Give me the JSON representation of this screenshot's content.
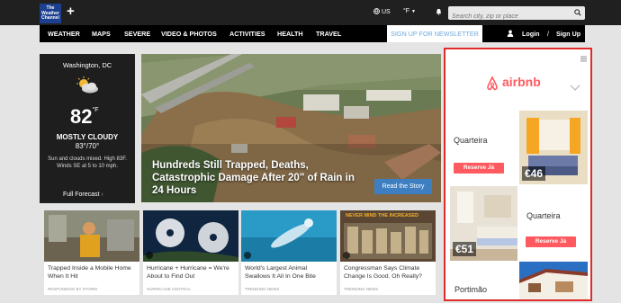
{
  "header": {
    "logo_text": "The Weather Channel",
    "location_code": "US",
    "unit": "°F",
    "search_placeholder": "Search city, zip or place"
  },
  "nav": {
    "items": [
      "WEATHER",
      "MAPS",
      "SEVERE",
      "VIDEO & PHOTOS",
      "ACTIVITIES",
      "HEALTH",
      "TRAVEL"
    ],
    "newsletter": "SIGN UP FOR NEWSLETTER",
    "login": "Login",
    "separator": "/",
    "signup": "Sign Up"
  },
  "weather": {
    "city": "Washington, DC",
    "temp": "82",
    "temp_unit": "°F",
    "condition": "MOSTLY CLOUDY",
    "hilo": "83°/70°",
    "description": "Sun and clouds mixed. High 83F. Winds SE at 5 to 10 mph.",
    "forecast_link": "Full Forecast"
  },
  "hero": {
    "title": "Hundreds Still Trapped, Deaths, Catastrophic Damage After 20\" of Rain in 24 Hours",
    "button": "Read the Story"
  },
  "cards": [
    {
      "title": "Trapped Inside a Mobile Home When It Hit",
      "source": "RESPONDING BY STORM"
    },
    {
      "title": "Hurricane + Hurricane = We're About to Find Out",
      "source": "HURRICANE CENTRAL"
    },
    {
      "title": "World's Largest Animal Swallows It All In One Bite",
      "source": "TRENDING NEWS"
    },
    {
      "title": "Congressman Says Climate Change Is Good. Oh Really?",
      "source": "TRENDING NEWS"
    }
  ],
  "card3_overlay": "NEVER MIND THE INCREASED",
  "ad": {
    "brand": "airbnb",
    "listings": [
      {
        "city": "Quarteira",
        "button": "Reserve Já",
        "price": "€46"
      },
      {
        "city": "Quarteira",
        "button": "Reserve Já",
        "price": "€51"
      },
      {
        "city": "Portimão"
      }
    ]
  },
  "colors": {
    "topbar": "#202020",
    "nav": "#000000",
    "accent_blue": "#3d7fc1",
    "airbnb": "#ff5a5f",
    "ad_highlight": "#e02b2b"
  }
}
